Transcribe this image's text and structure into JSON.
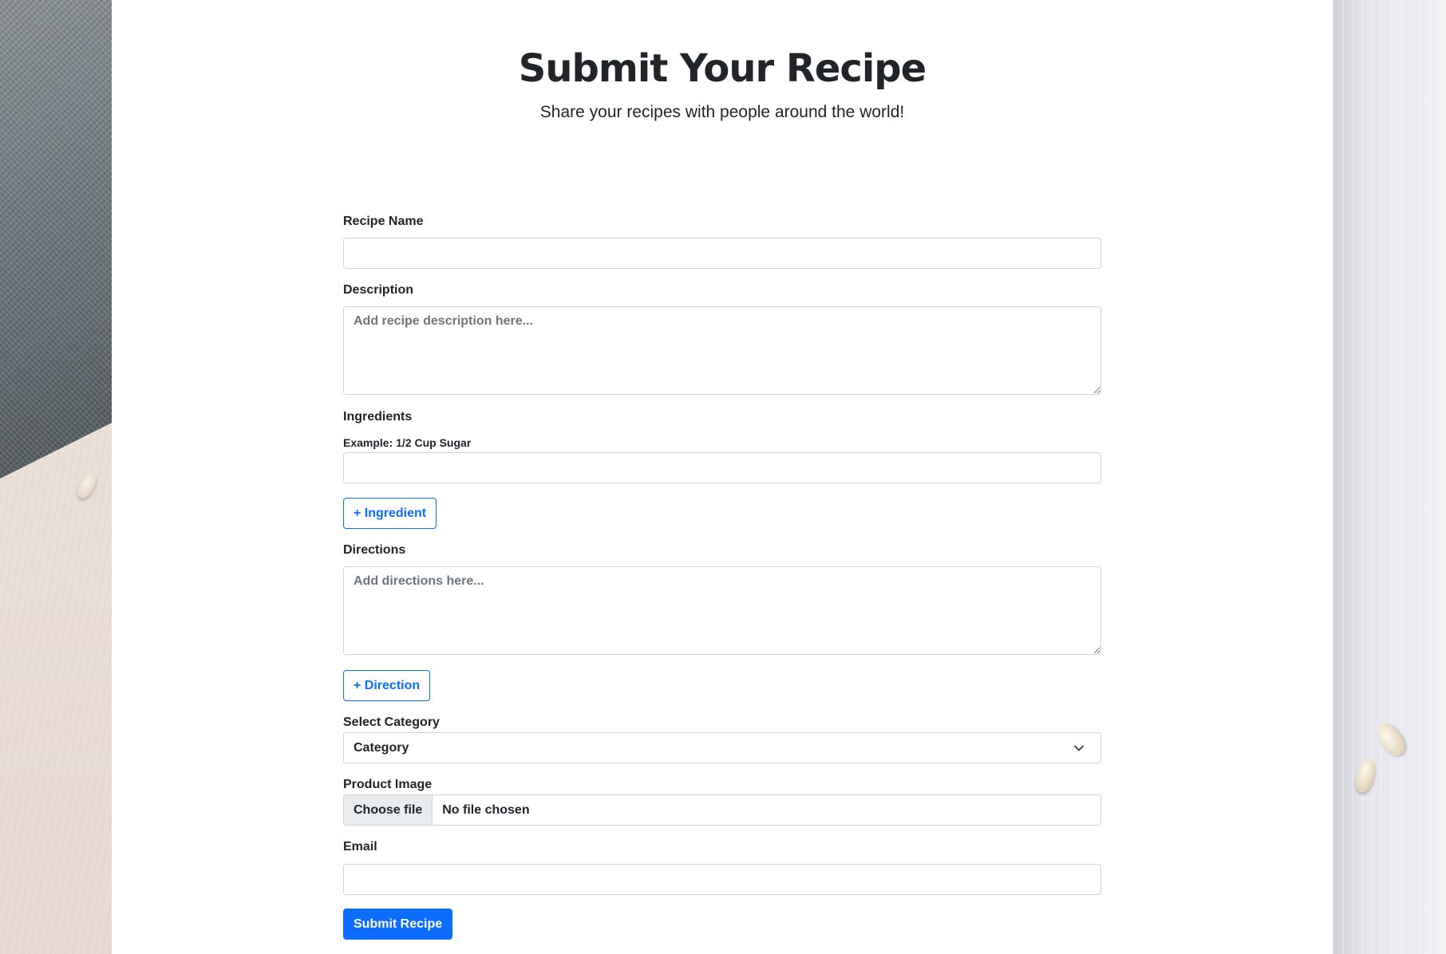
{
  "header": {
    "title": "Submit Your Recipe",
    "subtitle": "Share your recipes with people around the world!"
  },
  "form": {
    "recipe_name": {
      "label": "Recipe Name",
      "value": ""
    },
    "description": {
      "label": "Description",
      "placeholder": "Add recipe description here...",
      "value": ""
    },
    "ingredients": {
      "label": "Ingredients",
      "hint": "Example: 1/2 Cup Sugar",
      "value": "",
      "add_button_label": "+ Ingredient"
    },
    "directions": {
      "label": "Directions",
      "placeholder": "Add directions here...",
      "value": "",
      "add_button_label": "+ Direction"
    },
    "category": {
      "label": "Select Category",
      "selected": "Category"
    },
    "product_image": {
      "label": "Product Image",
      "button_label": "Choose file",
      "status": "No file chosen"
    },
    "email": {
      "label": "Email",
      "value": ""
    },
    "submit_label": "Submit Recipe"
  },
  "colors": {
    "primary": "#0d6efd",
    "border": "#ced4da",
    "text": "#212529",
    "placeholder": "#6c757d"
  }
}
